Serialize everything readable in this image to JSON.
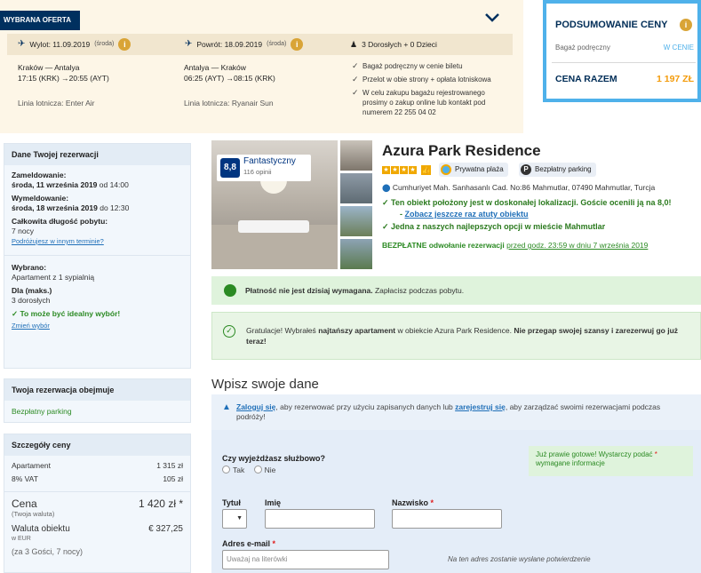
{
  "offer": {
    "tag": "WYBRANA OFERTA",
    "departure_label": "Wylot: 11.09.2019",
    "departure_day": "(środa)",
    "return_label": "Powrót: 18.09.2019",
    "return_day": "(środa)",
    "travelers": "3 Dorosłych + 0 Dzieci",
    "outbound": {
      "route": "Kraków — Antalya",
      "time": "17:15 (KRK) →20:55 (AYT)",
      "airline": "Linia lotnicza: Enter Air"
    },
    "inbound": {
      "route": "Antalya — Kraków",
      "time": "06:25 (AYT) →08:15 (KRK)",
      "airline": "Linia lotnicza: Ryanair Sun"
    },
    "checks": [
      "Bagaż podręczny w cenie biletu",
      "Przelot w obie strony + opłata lotniskowa",
      "W celu zakupu bagażu rejestrowanego prosimy o zakup online lub kontakt pod numerem 22 255 04 02"
    ]
  },
  "price_summary": {
    "title": "PODSUMOWANIE CENY",
    "row_label": "Bagaż podręczny",
    "row_value": "W CENIE",
    "total_label": "CENA RAZEM",
    "total_value": "1 197 ZŁ"
  },
  "reservation": {
    "title": "Dane Twojej rezerwacji",
    "checkin_label": "Zameldowanie:",
    "checkin_date": "środa, 11 września 2019",
    "checkin_time": " od 14:00",
    "checkout_label": "Wymeldowanie:",
    "checkout_date": "środa, 18 września 2019",
    "checkout_time": " do 12:30",
    "length_label": "Całkowita długość pobytu:",
    "length_value": "7 nocy",
    "change_dates": "Podróżujesz w innym terminie?",
    "chosen_label": "Wybrano:",
    "chosen_value": "Apartament z 1 sypialnią",
    "max_label": "Dla (maks.)",
    "max_value": "3 dorosłych",
    "ideal": "To może być idealny wybór!",
    "change_choice": "Zmień wybór"
  },
  "includes": {
    "title": "Twoja rezerwacja obejmuje",
    "item": "Bezpłatny parking"
  },
  "price_details": {
    "title": "Szczegóły ceny",
    "rows": [
      {
        "label": "Apartament",
        "value": "1 315 zł"
      },
      {
        "label": "8% VAT",
        "value": "105 zł"
      }
    ],
    "total_label": "Cena",
    "total_sub": "(Twoja waluta)",
    "total_value": "1 420 zł *",
    "local_label": "Waluta obiektu",
    "local_sub": "w EUR",
    "local_value": "€ 327,25",
    "guests_note": "(za 3 Gości, 7 nocy)"
  },
  "hotel": {
    "score": "8,8",
    "score_label": "Fantastyczny",
    "reviews": "116 opinii",
    "name": "Azura Park Residence",
    "amenity_beach": "Prywatna plaża",
    "amenity_parking": "Bezpłatny parking",
    "address": "Cumhuriyet Mah. Sanhasanlı Cad. No:86 Mahmutlar, 07490 Mahmutlar, Turcja",
    "highlight1": "Ten obiekt położony jest w doskonałej lokalizacji. Goście ocenili ją na 8,0!",
    "highlight_link": "Zobacz jeszcze raz atuty obiektu",
    "highlight2": "Jedna z naszych najlepszych opcji w mieście Mahmutlar",
    "cancel_bold": "BEZPŁATNE odwołanie rezerwacji",
    "cancel_rest": "przed godz. 23:59 w dniu 7 września 2019"
  },
  "notices": {
    "payment_bold": "Płatność nie jest dzisiaj wymagana.",
    "payment_rest": " Zapłacisz podczas pobytu.",
    "congrats_1": "Gratulacje! Wybrałeś ",
    "congrats_bold1": "najtańszy apartament",
    "congrats_2": " w obiekcie Azura Park Residence. ",
    "congrats_bold2": "Nie przegap swojej szansy i zarezerwuj go już teraz!"
  },
  "form": {
    "section_title": "Wpisz swoje dane",
    "login_link": "Zaloguj się",
    "login_mid": ", aby rezerwować przy użyciu zapisanych danych lub ",
    "register_link": "zarejestruj się",
    "login_end": ", aby zarządzać swoimi rezerwacjami podczas podróży!",
    "business_q": "Czy wyjeżdżasz służbowo?",
    "yes": "Tak",
    "no": "Nie",
    "ready_text": "Już prawie gotowe! Wystarczy podać",
    "ready_text2": "wymagane informacje",
    "title_label": "Tytuł",
    "first_label": "Imię",
    "last_label": "Nazwisko",
    "email_label": "Adres e-mail",
    "email_placeholder": "Uważaj na literówki",
    "email_note": "Na ten adres zostanie wysłane potwierdzenie"
  }
}
